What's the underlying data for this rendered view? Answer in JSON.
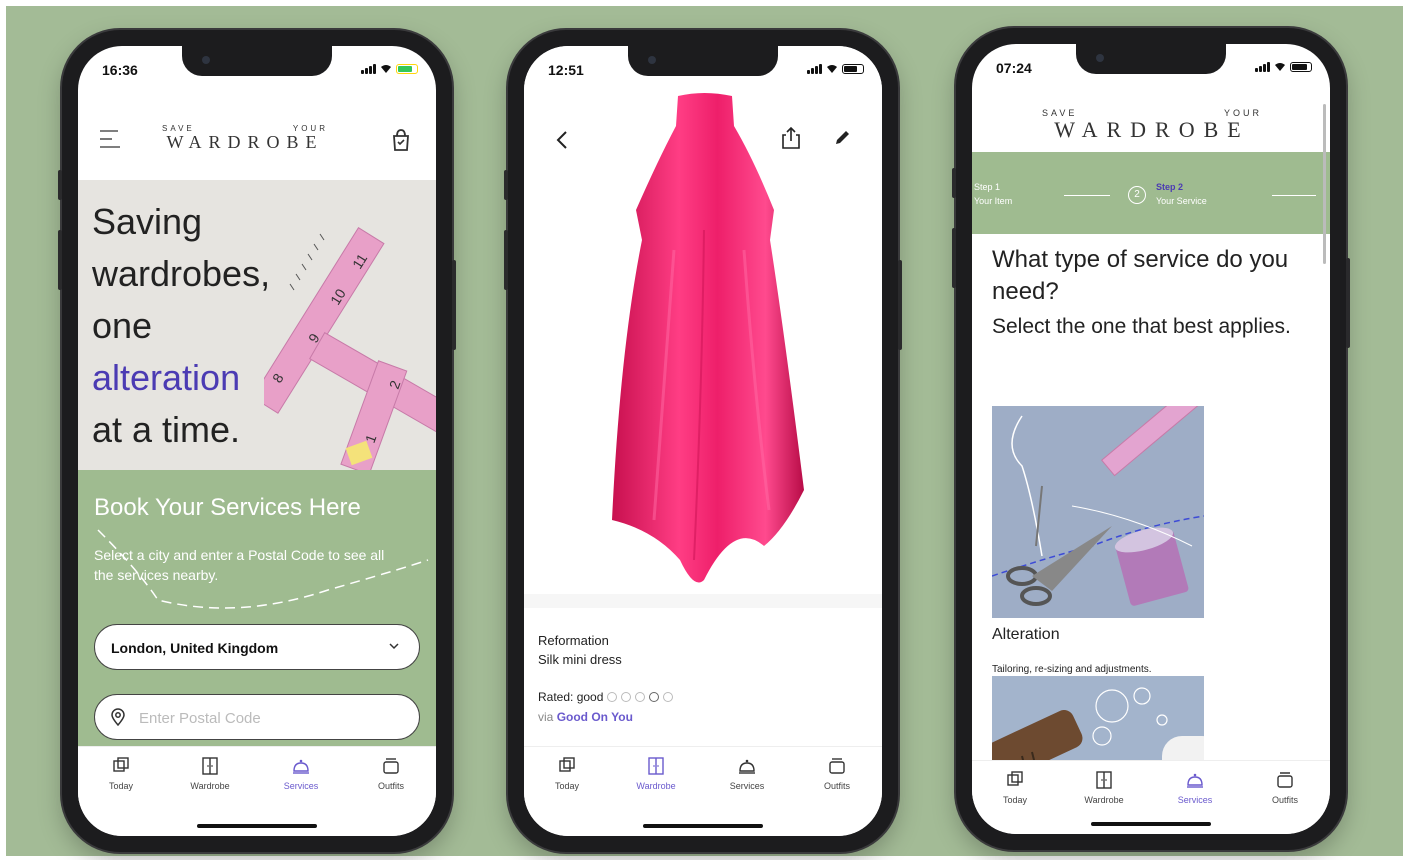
{
  "phones": [
    {
      "time": "16:36",
      "logo": {
        "small_left": "SAVE",
        "small_right": "YOUR",
        "big": "WARDROBE"
      },
      "hero": {
        "line1": "Saving",
        "line2": "wardrobes,",
        "line3": "one",
        "line4": "alteration",
        "line5": "at a time."
      },
      "booking": {
        "title": "Book Your Services Here",
        "subtitle": "Select a city and enter a Postal Code to see all the services nearby.",
        "city_value": "London, United Kingdom",
        "postal_placeholder": "Enter Postal Code"
      },
      "tabs": [
        "Today",
        "Wardrobe",
        "Services",
        "Outfits"
      ],
      "active_tab": "Services"
    },
    {
      "time": "12:51",
      "product": {
        "brand": "Reformation",
        "name": "Silk mini dress",
        "rated_label": "Rated: good",
        "via_prefix": "via",
        "via_source": "Good On You"
      },
      "tabs": [
        "Today",
        "Wardrobe",
        "Services",
        "Outfits"
      ],
      "active_tab": "Wardrobe"
    },
    {
      "time": "07:24",
      "logo": {
        "small_left": "SAVE",
        "small_right": "YOUR",
        "big": "WARDROBE"
      },
      "steps": {
        "step1_label": "Step 1",
        "step1_name": "Your Item",
        "step2_number": "2",
        "step2_label": "Step 2",
        "step2_name": "Your Service"
      },
      "question": "What type of service do you need?",
      "instruction": "Select the one that best applies.",
      "services": [
        {
          "title": "Alteration",
          "description": "Tailoring, re-sizing and adjustments."
        }
      ],
      "tabs": [
        "Today",
        "Wardrobe",
        "Services",
        "Outfits"
      ],
      "active_tab": "Services"
    }
  ],
  "colors": {
    "background": "#a3bb96",
    "panel_green": "#9fbb90",
    "accent_purple": "#4b3bb3",
    "dress_pink": "#ee1f6a"
  },
  "icons": [
    "menu-icon",
    "bag-icon",
    "back-icon",
    "share-icon",
    "edit-icon",
    "chevron-down-icon",
    "location-pin-icon",
    "today-icon",
    "wardrobe-icon",
    "services-icon",
    "outfits-icon"
  ]
}
